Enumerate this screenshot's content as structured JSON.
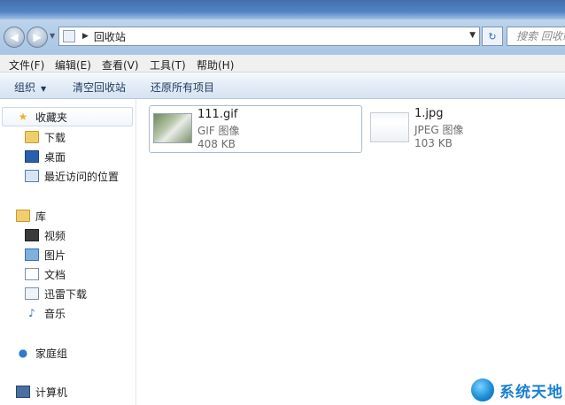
{
  "address": {
    "path": "回收站",
    "search_placeholder": "搜索 回收站"
  },
  "menu": [
    "文件(F)",
    "编辑(E)",
    "查看(V)",
    "工具(T)",
    "帮助(H)"
  ],
  "toolbar": {
    "organize": "组织",
    "empty": "清空回收站",
    "restore_all": "还原所有项目"
  },
  "nav": {
    "favorites": {
      "label": "收藏夹",
      "items": [
        "下载",
        "桌面",
        "最近访问的位置"
      ]
    },
    "libraries": {
      "label": "库",
      "items": [
        "视频",
        "图片",
        "文档",
        "迅雷下载",
        "音乐"
      ]
    },
    "homegroup": "家庭组",
    "computer": "计算机"
  },
  "files": [
    {
      "name": "111.gif",
      "type": "GIF 图像",
      "size": "408 KB"
    },
    {
      "name": "1.jpg",
      "type": "JPEG 图像",
      "size": "103 KB"
    }
  ],
  "watermark": "系统天地",
  "colors": {
    "accent": "#2f6fb4",
    "selection_border": "#a7bdd6"
  }
}
